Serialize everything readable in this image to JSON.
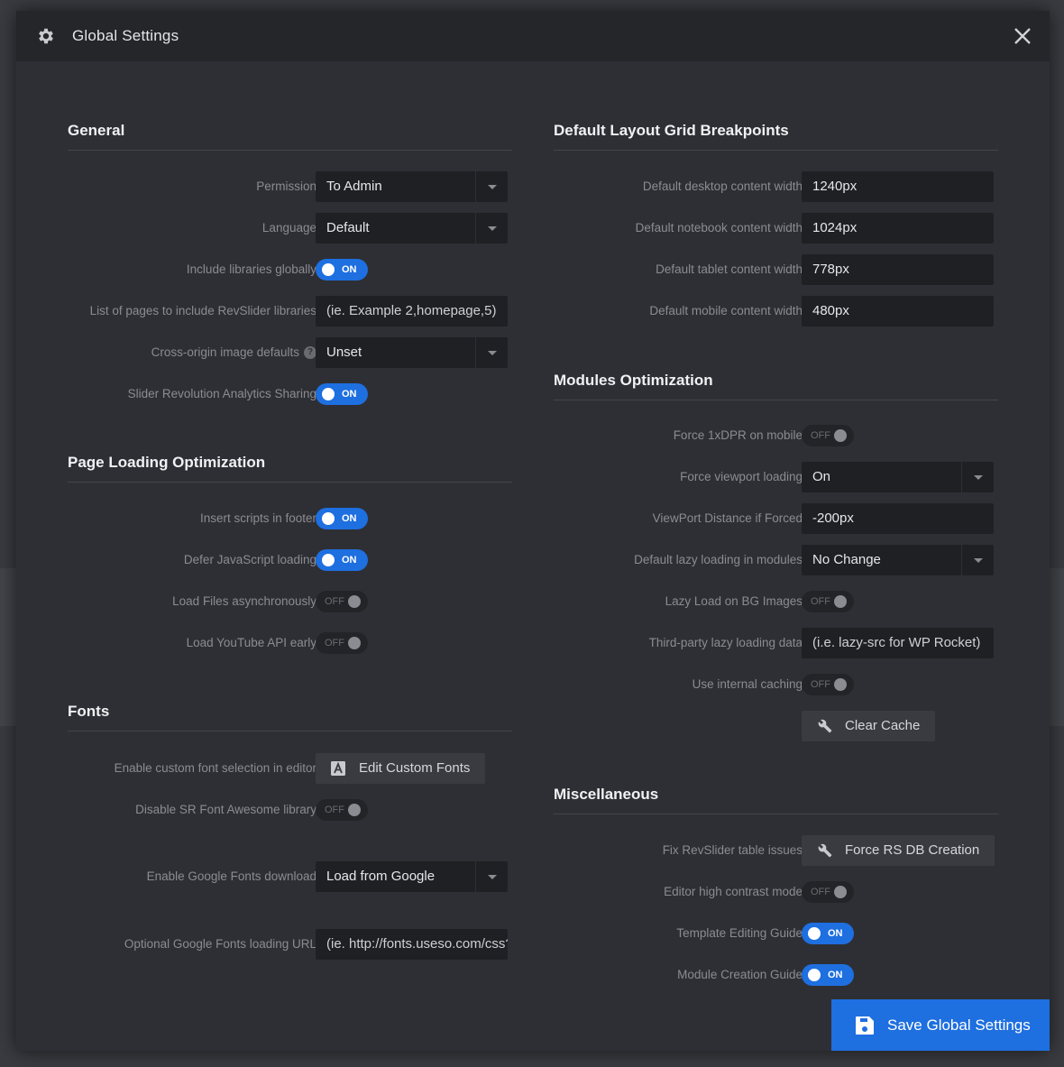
{
  "modal": {
    "title": "Global Settings",
    "icon": "gear-icon",
    "close_icon": "close-icon"
  },
  "general": {
    "title": "General",
    "permission": {
      "label": "Permission",
      "value": "To Admin"
    },
    "language": {
      "label": "Language",
      "value": "Default"
    },
    "include_libraries": {
      "label": "Include libraries globally",
      "state": "ON"
    },
    "pages_list": {
      "label": "List of pages to include RevSlider libraries",
      "placeholder": "(ie. Example 2,homepage,5)"
    },
    "cross_origin": {
      "label": "Cross-origin image defaults",
      "value": "Unset",
      "help": "?"
    },
    "analytics": {
      "label": "Slider Revolution Analytics Sharing",
      "state": "ON"
    }
  },
  "page_loading": {
    "title": "Page Loading Optimization",
    "scripts_footer": {
      "label": "Insert scripts in footer",
      "state": "ON"
    },
    "defer_js": {
      "label": "Defer JavaScript loading",
      "state": "ON"
    },
    "async_files": {
      "label": "Load Files asynchronously",
      "state": "OFF"
    },
    "youtube_api": {
      "label": "Load YouTube API early",
      "state": "OFF"
    }
  },
  "fonts": {
    "title": "Fonts",
    "custom_font": {
      "label": "Enable custom font selection in editor",
      "button": "Edit Custom Fonts"
    },
    "font_awesome": {
      "label": "Disable SR Font Awesome library",
      "state": "OFF"
    },
    "google_download": {
      "label": "Enable Google Fonts download",
      "value": "Load from Google"
    },
    "google_url": {
      "label": "Optional Google Fonts loading URL",
      "placeholder": "(ie. http://fonts.useso.com/css?family"
    }
  },
  "grid": {
    "title": "Default Layout Grid Breakpoints",
    "desktop": {
      "label": "Default desktop content width",
      "value": "1240px"
    },
    "notebook": {
      "label": "Default notebook content width",
      "value": "1024px"
    },
    "tablet": {
      "label": "Default tablet content width",
      "value": "778px"
    },
    "mobile": {
      "label": "Default mobile content width",
      "value": "480px"
    }
  },
  "modules": {
    "title": "Modules Optimization",
    "force_dpr": {
      "label": "Force 1xDPR on mobile",
      "state": "OFF"
    },
    "force_viewport": {
      "label": "Force viewport loading",
      "value": "On"
    },
    "viewport_distance": {
      "label": "ViewPort Distance if Forced",
      "value": "-200px"
    },
    "lazy_loading": {
      "label": "Default lazy loading in modules",
      "value": "No Change"
    },
    "lazy_bg": {
      "label": "Lazy Load on BG Images",
      "state": "OFF"
    },
    "third_party": {
      "label": "Third-party lazy loading data",
      "placeholder": "(i.e. lazy-src for WP Rocket)"
    },
    "internal_caching": {
      "label": "Use internal caching",
      "state": "OFF"
    },
    "clear_cache": {
      "button": "Clear Cache"
    }
  },
  "misc": {
    "title": "Miscellaneous",
    "fix_table": {
      "label": "Fix RevSlider table issues",
      "button": "Force RS DB Creation"
    },
    "high_contrast": {
      "label": "Editor high contrast mode",
      "state": "OFF"
    },
    "template_guide": {
      "label": "Template Editing Guide",
      "state": "ON"
    },
    "module_guide": {
      "label": "Module Creation Guide",
      "state": "ON"
    }
  },
  "footer": {
    "save_label": "Save Global Settings"
  },
  "colors": {
    "accent": "#1e6fe0",
    "panel": "#2e2f34",
    "header": "#252629",
    "input": "#1f2023"
  }
}
